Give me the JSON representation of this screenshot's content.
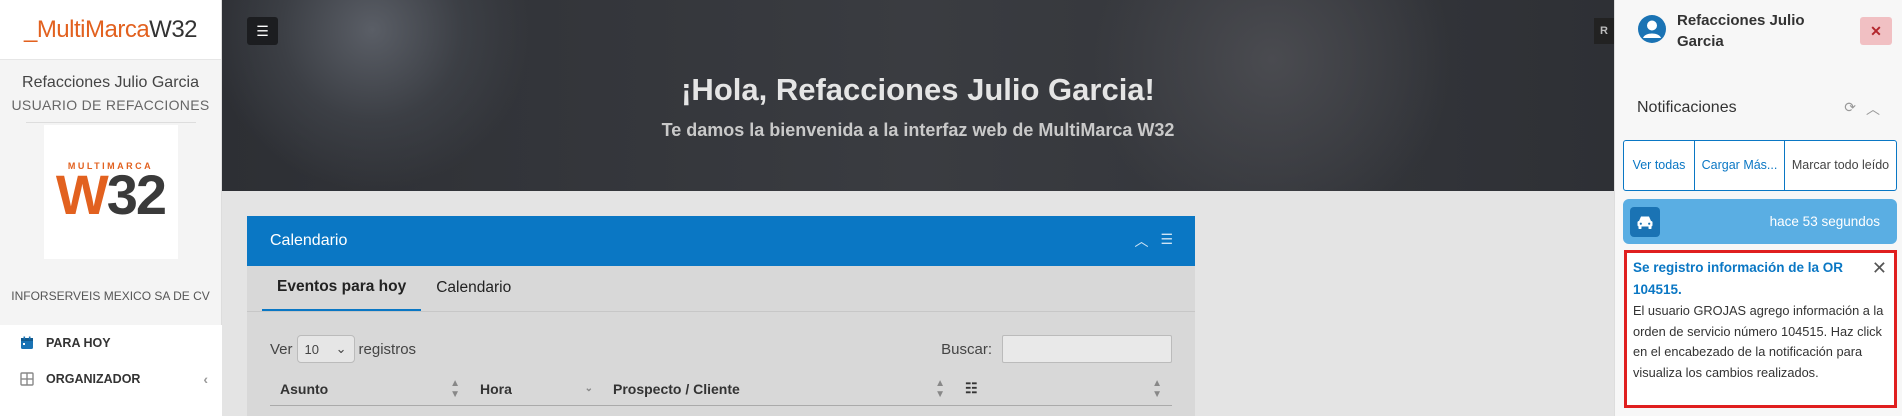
{
  "brand": {
    "prefix": "_MultiMarca",
    "suffix": "W32"
  },
  "sidebar": {
    "user_name": "Refacciones Julio Garcia",
    "user_role": "USUARIO DE REFACCIONES",
    "logo_small": "MULTIMARCA",
    "logo_w": "W",
    "logo_num": "32",
    "company": "INFORSERVEIS MEXICO SA DE CV",
    "menu": [
      {
        "label": "PARA HOY",
        "icon": "calendar-icon"
      },
      {
        "label": "ORGANIZADOR",
        "icon": "grid-icon"
      }
    ]
  },
  "hero": {
    "title": "¡Hola, Refacciones Julio Garcia!",
    "subtitle": "Te damos la bienvenida a la interfaz web de MultiMarca W32",
    "right_stub": "R"
  },
  "card": {
    "title": "Calendario",
    "tabs": [
      "Eventos para hoy",
      "Calendario"
    ],
    "show_label": "Ver",
    "show_value": "10",
    "records_label": "registros",
    "search_label": "Buscar:",
    "columns": [
      "Asunto",
      "Hora",
      "Prospecto / Cliente"
    ]
  },
  "panel": {
    "user_name": "Refacciones Julio Garcia",
    "close": "✕",
    "notifications_title": "Notificaciones",
    "buttons": {
      "view_all": "Ver todas",
      "load_more": "Cargar Más...",
      "mark_read": "Marcar todo leído"
    },
    "notif_time": "hace 53 segundos",
    "msg_title": "Se registro información de la OR 104515.",
    "msg_body": "El usuario GROJAS agrego información a la orden de servicio número 104515. Haz click en el encabezado de la notificación para visualiza los cambios realizados."
  },
  "colors": {
    "brand_orange": "#e2611f",
    "primary_blue": "#0a77c4",
    "alert_red": "#e01f1f"
  }
}
